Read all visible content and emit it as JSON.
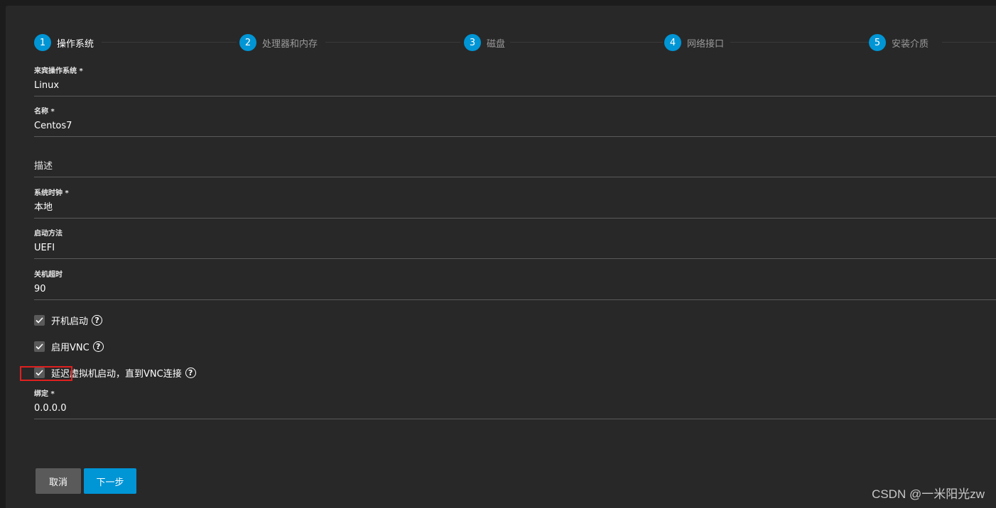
{
  "stepper": {
    "steps": [
      {
        "num": "1",
        "label": "操作系统",
        "active": true
      },
      {
        "num": "2",
        "label": "处理器和内存",
        "active": false
      },
      {
        "num": "3",
        "label": "磁盘",
        "active": false
      },
      {
        "num": "4",
        "label": "网络接口",
        "active": false
      },
      {
        "num": "5",
        "label": "安装介质",
        "active": false
      }
    ]
  },
  "form": {
    "guest_os": {
      "label": "来宾操作系统 *",
      "value": "Linux"
    },
    "name": {
      "label": "名称 *",
      "value": "Centos7"
    },
    "description": {
      "label": "",
      "placeholder": "描述"
    },
    "system_clock": {
      "label": "系统时钟 *",
      "value": "本地"
    },
    "boot_method": {
      "label": "启动方法",
      "value": "UEFI"
    },
    "shutdown_timeout": {
      "label": "关机超时",
      "value": "90"
    },
    "autostart": {
      "label": "开机启动",
      "checked": true
    },
    "enable_vnc": {
      "label": "启用VNC",
      "checked": true
    },
    "delay_vm_boot": {
      "label": "延迟虚拟机启动，直到VNC连接",
      "checked": true
    },
    "bind": {
      "label": "绑定 *",
      "value": "0.0.0.0"
    }
  },
  "actions": {
    "cancel_label": "取消",
    "next_label": "下一步"
  },
  "help_glyph": "?",
  "check_icon": "checkmark-icon",
  "watermark": "CSDN @一米阳光zw",
  "colors": {
    "accent": "#0095d5",
    "panel_bg": "#282828",
    "page_bg": "#1c1c1c",
    "checkbox_bg": "#5a5a5a",
    "cancel_bg": "#5a5a5a",
    "highlight": "#e02020"
  }
}
